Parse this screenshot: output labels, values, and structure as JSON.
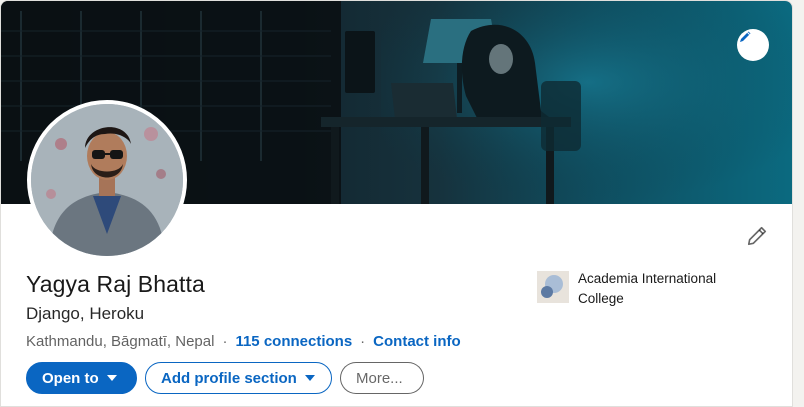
{
  "profile": {
    "name": "Yagya Raj Bhatta",
    "headline": "Django, Heroku",
    "location": "Kathmandu, Bāgmatī, Nepal",
    "separator": "·",
    "connections": "115 connections",
    "contact_info": "Contact info"
  },
  "education": {
    "org_name": "Academia International College"
  },
  "actions": {
    "open_to": "Open to",
    "add_profile_section": "Add profile section",
    "more": "More..."
  },
  "colors": {
    "accent": "#0a66c2",
    "banner_teal": "#0b6a80"
  },
  "icons": {
    "banner_edit": "pencil-icon",
    "intro_edit": "pencil-icon",
    "caret": "caret-down-icon"
  }
}
